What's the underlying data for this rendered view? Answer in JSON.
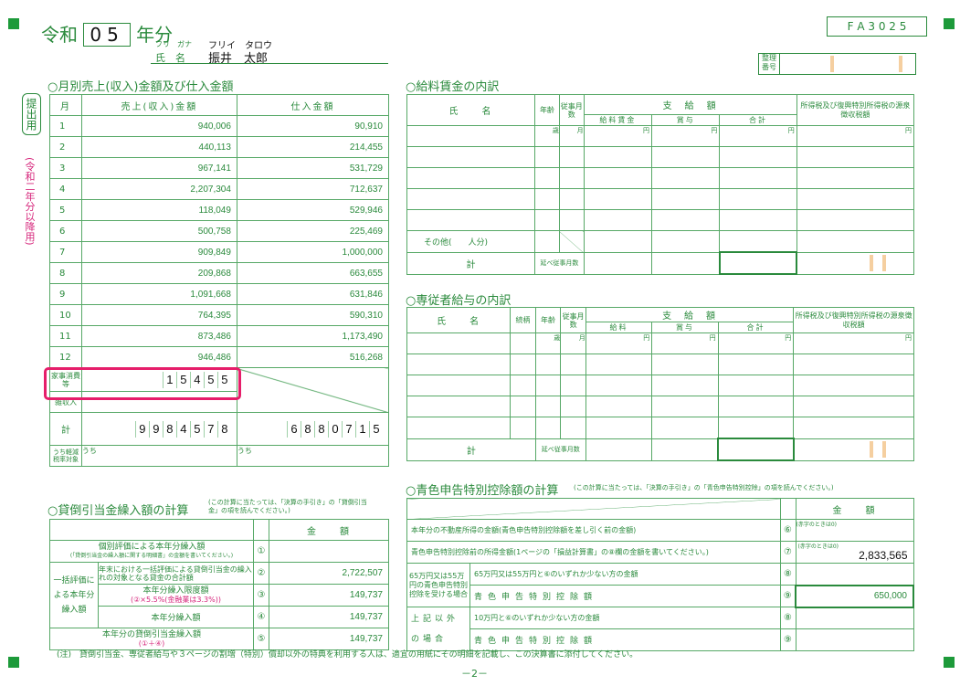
{
  "header": {
    "era": "令和",
    "year": "05",
    "year_suffix": "年分",
    "form_code": "F A 3 0 2 5",
    "furigana_label": "フリ　ガナ",
    "furigana_value": "フリイ　タロウ",
    "name_label": "氏　名",
    "name_value": "振井　太郎",
    "seiri_label": "整理番号"
  },
  "side": {
    "submit": "提出用",
    "period": "(令和二年分以降用)"
  },
  "sales": {
    "title": "○月別売上(収入)金額及び仕入金額",
    "col_month": "月",
    "col_sales": "売上(収入)金額",
    "col_purchase": "仕入金額",
    "yen": "円",
    "rows": [
      {
        "m": "1",
        "s": "940,006",
        "p": "90,910"
      },
      {
        "m": "2",
        "s": "440,113",
        "p": "214,455"
      },
      {
        "m": "3",
        "s": "967,141",
        "p": "531,729"
      },
      {
        "m": "4",
        "s": "2,207,304",
        "p": "712,637"
      },
      {
        "m": "5",
        "s": "118,049",
        "p": "529,946"
      },
      {
        "m": "6",
        "s": "500,758",
        "p": "225,469"
      },
      {
        "m": "7",
        "s": "909,849",
        "p": "1,000,000"
      },
      {
        "m": "8",
        "s": "209,868",
        "p": "663,655"
      },
      {
        "m": "9",
        "s": "1,091,668",
        "p": "631,846"
      },
      {
        "m": "10",
        "s": "764,395",
        "p": "590,310"
      },
      {
        "m": "11",
        "s": "873,486",
        "p": "1,173,490"
      },
      {
        "m": "12",
        "s": "946,486",
        "p": "516,268"
      }
    ],
    "kaji_label": "家事消費等",
    "kaji_digits": [
      "1",
      "5",
      "4",
      "5",
      "5"
    ],
    "zatsu_label": "雑収入",
    "total_label": "計",
    "total_sales_digits": [
      "9",
      "9",
      "8",
      "4",
      "5",
      "7",
      "8"
    ],
    "total_purchase_digits": [
      "6",
      "8",
      "8",
      "0",
      "7",
      "1",
      "5"
    ],
    "uchi_label": "うち軽減税率対象",
    "uchi": "うち"
  },
  "salary": {
    "title": "○給料賃金の内訳",
    "cols": [
      "氏　　名",
      "年齢",
      "従事月数",
      "給料賃金",
      "賞与",
      "合計",
      "所得税及び復興特別所得税の源泉徴収税額"
    ],
    "shikyu": "支　給　額",
    "age_unit": "歳",
    "month_unit": "月",
    "yen": "円",
    "other": "その他(　　人分)",
    "total": "計",
    "nobe": "延べ従事月数"
  },
  "senju": {
    "title": "○専従者給与の内訳",
    "cols": [
      "氏　　名",
      "続柄",
      "年齢",
      "従事月数",
      "給料",
      "賞与",
      "合計",
      "所得税及び復興特別所得税の源泉徴収税額"
    ],
    "shikyu": "支　給　額",
    "total": "計",
    "nobe": "延べ従事月数"
  },
  "kashidaore": {
    "title": "○貸倒引当金繰入額の計算",
    "note": "(この計算に当たっては、「決算の手引き」の「貸倒引当金」の項を読んでください。)",
    "col_amount": "金　　額",
    "rows": [
      {
        "label": "個別評価による本年分繰入額",
        "sub": "(「貸倒引当金の繰入額に関する明細書」の金額を書いてください。)",
        "no": "①",
        "value": ""
      },
      {
        "label": "年末における一括評価による貸倒引当金の繰入れの対象となる貸金の合計額",
        "no": "②",
        "value": "2,722,507"
      },
      {
        "label": "本年分繰入限度額",
        "sub": "(②×5.5%(金融業は3.3%))",
        "no": "③",
        "value": "149,737"
      },
      {
        "label": "本年分繰入額",
        "no": "④",
        "value": "149,737"
      },
      {
        "label": "本年分の貸倒引当金繰入額",
        "sub": "(①＋④)",
        "no": "⑤",
        "value": "149,737"
      }
    ],
    "ikkatsu": "一括評価による本年分繰入額"
  },
  "aoiro": {
    "title": "○青色申告特別控除額の計算",
    "note": "(この計算に当たっては、「決算の手引き」の「青色申告特別控除」の項を読んでください。)",
    "col_amount": "金　　額",
    "rows": [
      {
        "label": "本年分の不動産所得の金額(青色申告特別控除額を差し引く前の金額)",
        "no": "⑥",
        "pre": "(赤字のときは0)",
        "value": ""
      },
      {
        "label": "青色申告特別控除前の所得金額(1ページの「損益計算書」の⑧欄の金額を書いてください。)",
        "no": "⑦",
        "pre": "(赤字のときは0)",
        "value": "2,833,565"
      },
      {
        "label": "65万円又は55万円と⑥のいずれか少ない方の金額",
        "no": "⑧",
        "pre": "",
        "value": ""
      },
      {
        "label": "青色申告特別控除額",
        "no": "⑨",
        "pre": "",
        "value": "650,000"
      },
      {
        "label": "10万円と⑥のいずれか少ない方の金額",
        "no": "⑧",
        "pre": "",
        "value": ""
      },
      {
        "label": "青色申告特別控除額",
        "no": "⑨",
        "pre": "",
        "value": ""
      }
    ],
    "g1": "65万円又は55万円の青色申告特別控除を受ける場合",
    "g2": "上記以外の場合"
  },
  "footer": {
    "note": "(注)　貸倒引当金、専従者給与や３ページの割増（特別）償却以外の特典を利用する人は、適宜の用紙にその明細を記載し、この決算書に添付してください。",
    "page": "－2－"
  }
}
